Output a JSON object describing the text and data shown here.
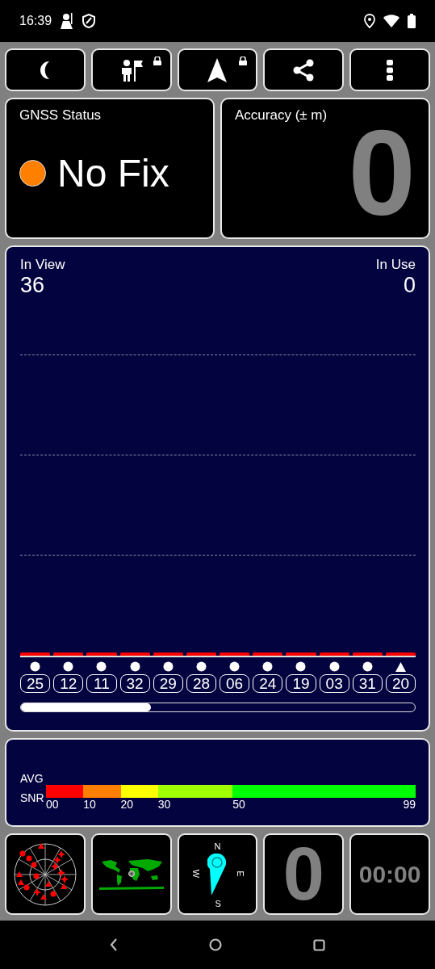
{
  "status_bar": {
    "time": "16:39"
  },
  "toolbar": {
    "buttons": [
      {
        "kind": "moon",
        "locked": false
      },
      {
        "kind": "person-flag",
        "locked": true
      },
      {
        "kind": "navigation",
        "locked": true
      },
      {
        "kind": "share",
        "locked": false
      },
      {
        "kind": "more",
        "locked": false
      }
    ]
  },
  "gnss_status": {
    "title": "GNSS Status",
    "status": "No Fix",
    "color": "#ff8000"
  },
  "accuracy": {
    "title": "Accuracy (± m)",
    "value": "0"
  },
  "satellites": {
    "in_view_label": "In View",
    "in_view": "36",
    "in_use_label": "In Use",
    "in_use": "0",
    "items": [
      {
        "prn": "25",
        "kind": "circle"
      },
      {
        "prn": "12",
        "kind": "circle"
      },
      {
        "prn": "11",
        "kind": "circle"
      },
      {
        "prn": "32",
        "kind": "circle"
      },
      {
        "prn": "29",
        "kind": "circle"
      },
      {
        "prn": "28",
        "kind": "circle"
      },
      {
        "prn": "06",
        "kind": "circle"
      },
      {
        "prn": "24",
        "kind": "circle"
      },
      {
        "prn": "19",
        "kind": "circle"
      },
      {
        "prn": "03",
        "kind": "circle"
      },
      {
        "prn": "31",
        "kind": "circle"
      },
      {
        "prn": "20",
        "kind": "triangle"
      }
    ]
  },
  "snr_legend": {
    "label_top": "AVG",
    "label_bottom": "SNR",
    "segments": [
      {
        "label": "00",
        "color": "#ff0000"
      },
      {
        "label": "10",
        "color": "#ff8000"
      },
      {
        "label": "20",
        "color": "#ffff00"
      },
      {
        "label": "30",
        "color": "#a0ff00"
      },
      {
        "label": "50",
        "color": "#00ff00"
      }
    ],
    "end_label": "99"
  },
  "tiles": {
    "compass": {
      "north": "N",
      "east": "E",
      "south": "S",
      "west": "W"
    },
    "speed": "0",
    "timer": "00:00"
  }
}
